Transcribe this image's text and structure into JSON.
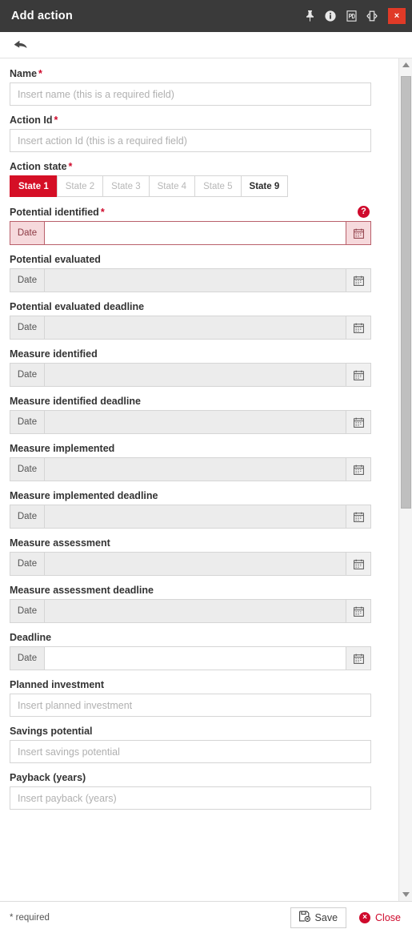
{
  "titlebar": {
    "title": "Add action",
    "icons": [
      {
        "name": "pin-icon",
        "label": "Pin"
      },
      {
        "name": "info-icon",
        "label": "Info"
      },
      {
        "name": "pdf-icon",
        "label": "Export PDF"
      },
      {
        "name": "expand-icon",
        "label": "Expand"
      }
    ],
    "close_label": "×"
  },
  "toolbar": {
    "back_label": "Back"
  },
  "form": {
    "name": {
      "label": "Name",
      "required": "*",
      "placeholder": "Insert name (this is a required field)",
      "value": ""
    },
    "action_id": {
      "label": "Action Id",
      "required": "*",
      "placeholder": "Insert action Id (this is a required field)",
      "value": ""
    },
    "action_state": {
      "label": "Action state",
      "required": "*",
      "options": [
        {
          "label": "State 1",
          "state": "active"
        },
        {
          "label": "State 2",
          "state": "disabled"
        },
        {
          "label": "State 3",
          "state": "disabled"
        },
        {
          "label": "State 4",
          "state": "disabled"
        },
        {
          "label": "State 5",
          "state": "disabled"
        },
        {
          "label": "State 9",
          "state": "enabled"
        }
      ],
      "selected": "State 1"
    },
    "date_addon_label": "Date",
    "date_fields": [
      {
        "label": "Potential identified",
        "required": "*",
        "value": "",
        "state": "error",
        "help": "?"
      },
      {
        "label": "Potential evaluated",
        "required": "",
        "value": "",
        "state": "disabled",
        "help": ""
      },
      {
        "label": "Potential evaluated deadline",
        "required": "",
        "value": "",
        "state": "disabled",
        "help": ""
      },
      {
        "label": "Measure identified",
        "required": "",
        "value": "",
        "state": "disabled",
        "help": ""
      },
      {
        "label": "Measure identified deadline",
        "required": "",
        "value": "",
        "state": "disabled",
        "help": ""
      },
      {
        "label": "Measure implemented",
        "required": "",
        "value": "",
        "state": "disabled",
        "help": ""
      },
      {
        "label": "Measure implemented deadline",
        "required": "",
        "value": "",
        "state": "disabled",
        "help": ""
      },
      {
        "label": "Measure assessment",
        "required": "",
        "value": "",
        "state": "disabled",
        "help": ""
      },
      {
        "label": "Measure assessment deadline",
        "required": "",
        "value": "",
        "state": "disabled",
        "help": ""
      },
      {
        "label": "Deadline",
        "required": "",
        "value": "",
        "state": "enabled",
        "help": ""
      }
    ],
    "planned_investment": {
      "label": "Planned investment",
      "placeholder": "Insert planned investment",
      "value": ""
    },
    "savings_potential": {
      "label": "Savings potential",
      "placeholder": "Insert savings potential",
      "value": ""
    },
    "payback": {
      "label": "Payback (years)",
      "placeholder": "Insert payback (years)",
      "value": ""
    }
  },
  "footer": {
    "required_note": "* required",
    "save_label": "Save",
    "close_label": "Close",
    "close_glyph": "×"
  },
  "colors": {
    "accent_red": "#d50f26",
    "titlebar_bg": "#3a3a3a",
    "close_red": "#e03a27",
    "disabled_field": "#ececec",
    "error_border": "#b9606b",
    "error_bg": "#f6d9dc"
  }
}
